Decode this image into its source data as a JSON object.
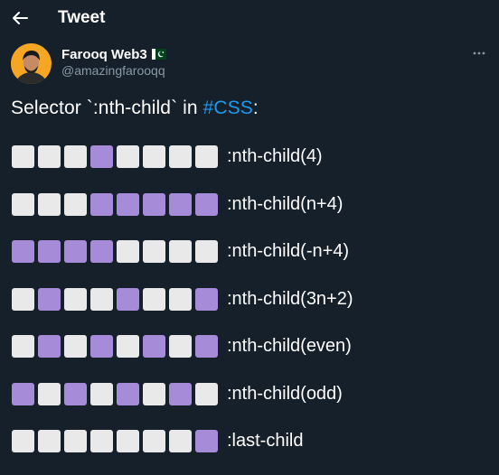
{
  "header": {
    "title": "Tweet"
  },
  "author": {
    "name": "Farooq Web3",
    "handle": "@amazingfarooqq"
  },
  "tweet": {
    "text_before": "Selector `:nth-child` in ",
    "hashtag": "#CSS",
    "text_after": ":"
  },
  "colors": {
    "active": "#a68bd8",
    "inactive": "#e9e9ea",
    "hashtag": "#1d9bf0",
    "background": "#15202b"
  },
  "rows": [
    {
      "label": ":nth-child(4)",
      "selected": [
        4
      ]
    },
    {
      "label": ":nth-child(n+4)",
      "selected": [
        4,
        5,
        6,
        7,
        8
      ]
    },
    {
      "label": ":nth-child(-n+4)",
      "selected": [
        1,
        2,
        3,
        4
      ]
    },
    {
      "label": ":nth-child(3n+2)",
      "selected": [
        2,
        5,
        8
      ]
    },
    {
      "label": ":nth-child(even)",
      "selected": [
        2,
        4,
        6,
        8
      ]
    },
    {
      "label": ":nth-child(odd)",
      "selected": [
        1,
        3,
        5,
        7
      ]
    },
    {
      "label": ":last-child",
      "selected": [
        8
      ]
    }
  ]
}
